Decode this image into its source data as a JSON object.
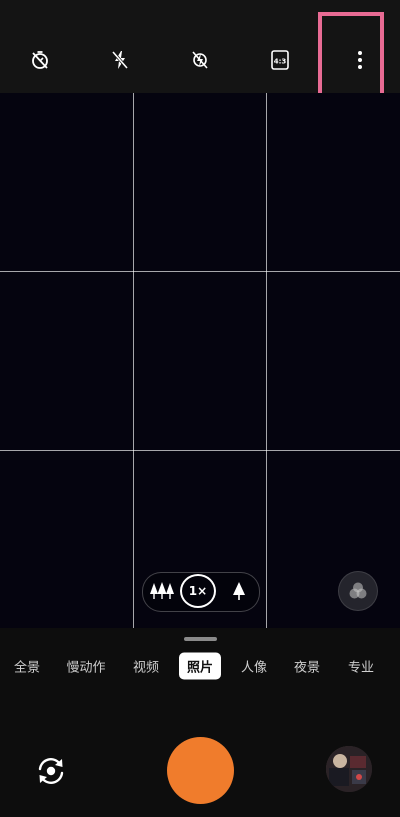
{
  "top_bar": {
    "icons": [
      {
        "name": "timer-off-icon"
      },
      {
        "name": "flash-off-icon"
      },
      {
        "name": "hdr-off-icon"
      },
      {
        "name": "aspect-ratio-icon",
        "label": "4:3"
      },
      {
        "name": "more-options-icon"
      }
    ]
  },
  "zoom": {
    "current": "1×",
    "wide_icon": "tree-group-icon",
    "tele_icon": "single-tree-icon"
  },
  "modes": [
    {
      "label": "全景"
    },
    {
      "label": "慢动作"
    },
    {
      "label": "视频"
    },
    {
      "label": "照片",
      "active": true
    },
    {
      "label": "人像"
    },
    {
      "label": "夜景"
    },
    {
      "label": "专业"
    }
  ],
  "colors": {
    "shutter": "#f07c2c",
    "highlight_box": "#e86b94",
    "viewfinder": "#05040f"
  }
}
